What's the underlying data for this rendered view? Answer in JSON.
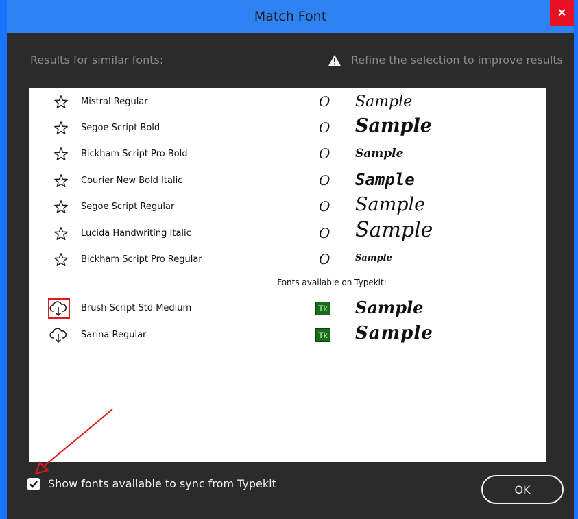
{
  "window": {
    "title": "Match Font",
    "close_label": "×"
  },
  "header": {
    "results_label": "Results for similar fonts:",
    "refine_text": "Refine the selection to improve results"
  },
  "fonts": [
    {
      "name": "Mistral Regular",
      "glyph": "O",
      "sample": "Sample"
    },
    {
      "name": "Segoe Script Bold",
      "glyph": "O",
      "sample": "Sample"
    },
    {
      "name": "Bickham Script Pro Bold",
      "glyph": "O",
      "sample": "Sample"
    },
    {
      "name": "Courier New Bold Italic",
      "glyph": "O",
      "sample": "Sample"
    },
    {
      "name": "Segoe Script Regular",
      "glyph": "O",
      "sample": "Sample"
    },
    {
      "name": "Lucida Handwriting Italic",
      "glyph": "O",
      "sample": "Sample"
    },
    {
      "name": "Bickham Script Pro Regular",
      "glyph": "O",
      "sample": "Sample"
    }
  ],
  "typekit": {
    "section_label": "Fonts available on Typekit:",
    "badge": "Tk",
    "fonts": [
      {
        "name": "Brush Script Std Medium",
        "sample": "Sample"
      },
      {
        "name": "Sarina Regular",
        "sample": "Sample"
      }
    ]
  },
  "footer": {
    "checkbox_label": "Show fonts available to sync from Typekit",
    "checkbox_checked": true,
    "ok_label": "OK"
  },
  "colors": {
    "titlebar": "#2f82f2",
    "close": "#e81123",
    "highlight": "#e01818",
    "typekit_badge": "#1b6b1b"
  },
  "icons": {
    "star": "star-outline-icon",
    "cloud": "cloud-download-icon",
    "warning": "warning-icon",
    "check": "checkmark-icon"
  }
}
